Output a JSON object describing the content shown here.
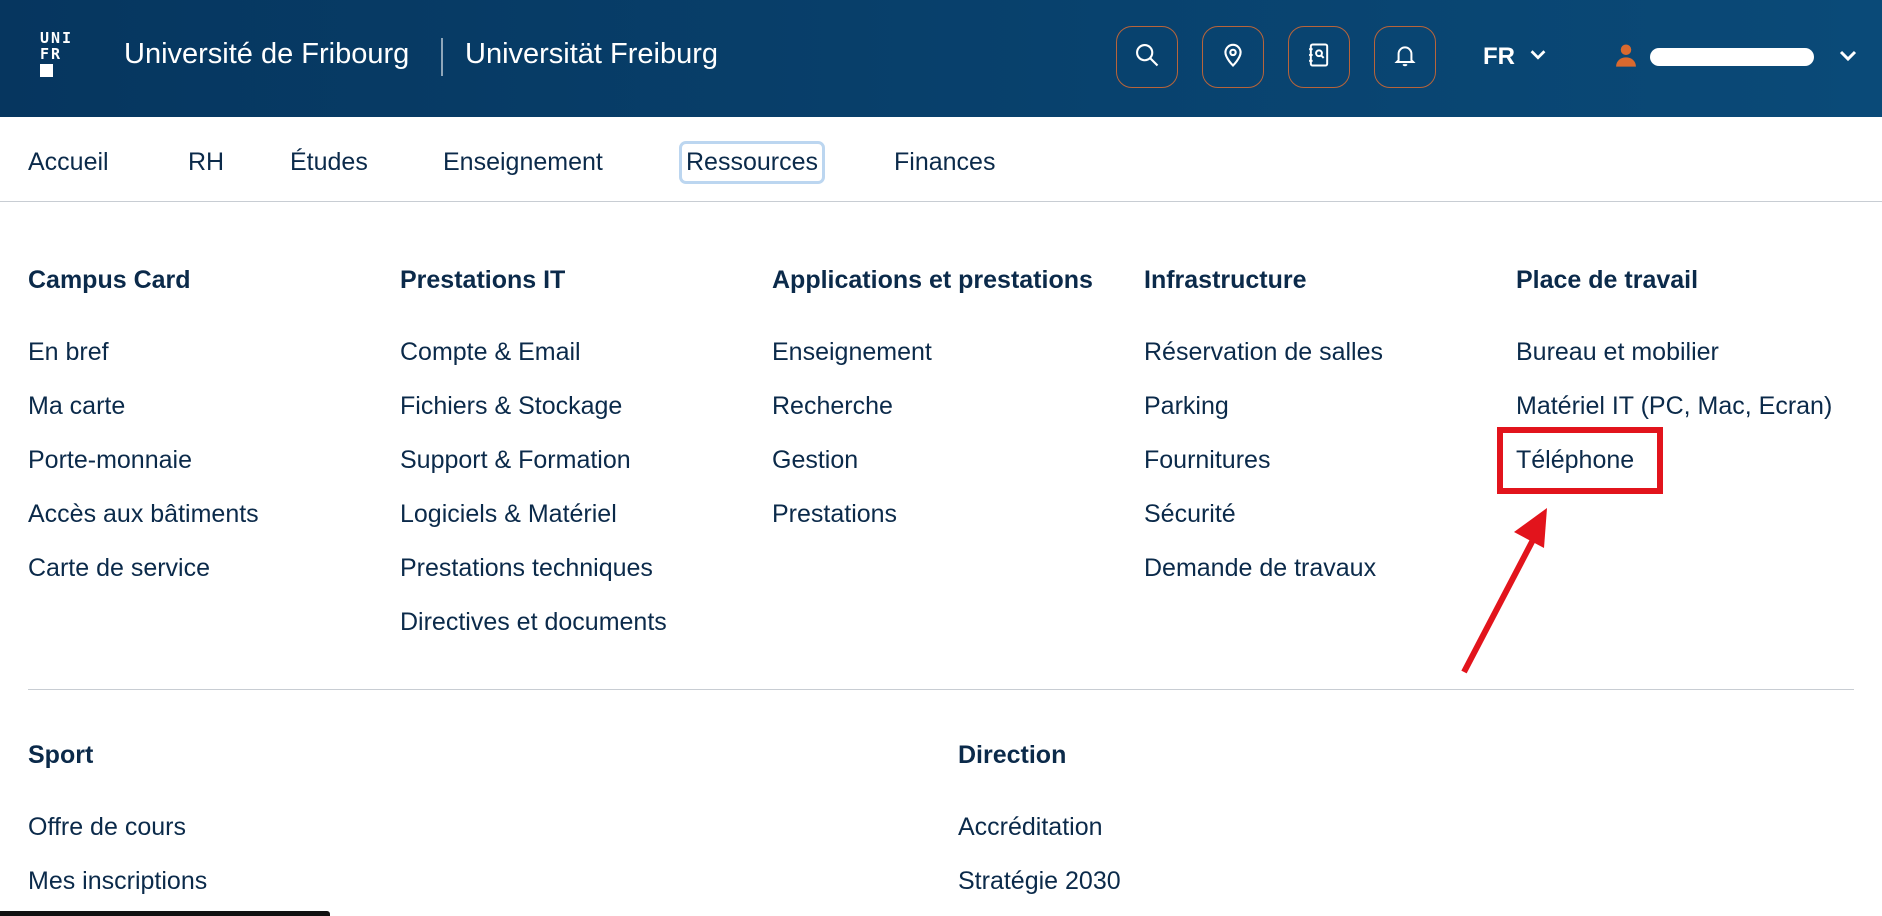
{
  "header": {
    "logo_lines": [
      "UNI",
      "FR"
    ],
    "title_fr": "Université de Fribourg",
    "title_de": "Universität Freiburg",
    "language": "FR"
  },
  "nav": {
    "items": [
      "Accueil",
      "RH",
      "Études",
      "Enseignement",
      "Ressources",
      "Finances"
    ],
    "active": "Ressources"
  },
  "menu": {
    "columns": [
      {
        "title": "Campus Card",
        "links": [
          "En bref",
          "Ma carte",
          "Porte-monnaie",
          "Accès aux bâtiments",
          "Carte de service"
        ]
      },
      {
        "title": "Prestations IT",
        "links": [
          "Compte & Email",
          "Fichiers & Stockage",
          "Support & Formation",
          "Logiciels & Matériel",
          "Prestations techniques",
          "Directives et documents"
        ]
      },
      {
        "title": "Applications et prestations",
        "links": [
          "Enseignement",
          "Recherche",
          "Gestion",
          "Prestations"
        ]
      },
      {
        "title": "Infrastructure",
        "links": [
          "Réservation de salles",
          "Parking",
          "Fournitures",
          "Sécurité",
          "Demande de travaux"
        ]
      },
      {
        "title": "Place de travail",
        "links": [
          "Bureau et mobilier",
          "Matériel IT (PC, Mac, Ecran)",
          "Téléphone"
        ]
      }
    ],
    "lower": [
      {
        "title": "Sport",
        "links": [
          "Offre de cours",
          "Mes inscriptions"
        ]
      },
      {
        "title": "Direction",
        "links": [
          "Accréditation",
          "Stratégie 2030"
        ]
      }
    ]
  },
  "icons": {
    "header_buttons": [
      "search-icon",
      "location-pin-icon",
      "directory-icon",
      "bell-icon"
    ],
    "accent": "#d9692e",
    "annotation_color": "#e2141c"
  }
}
